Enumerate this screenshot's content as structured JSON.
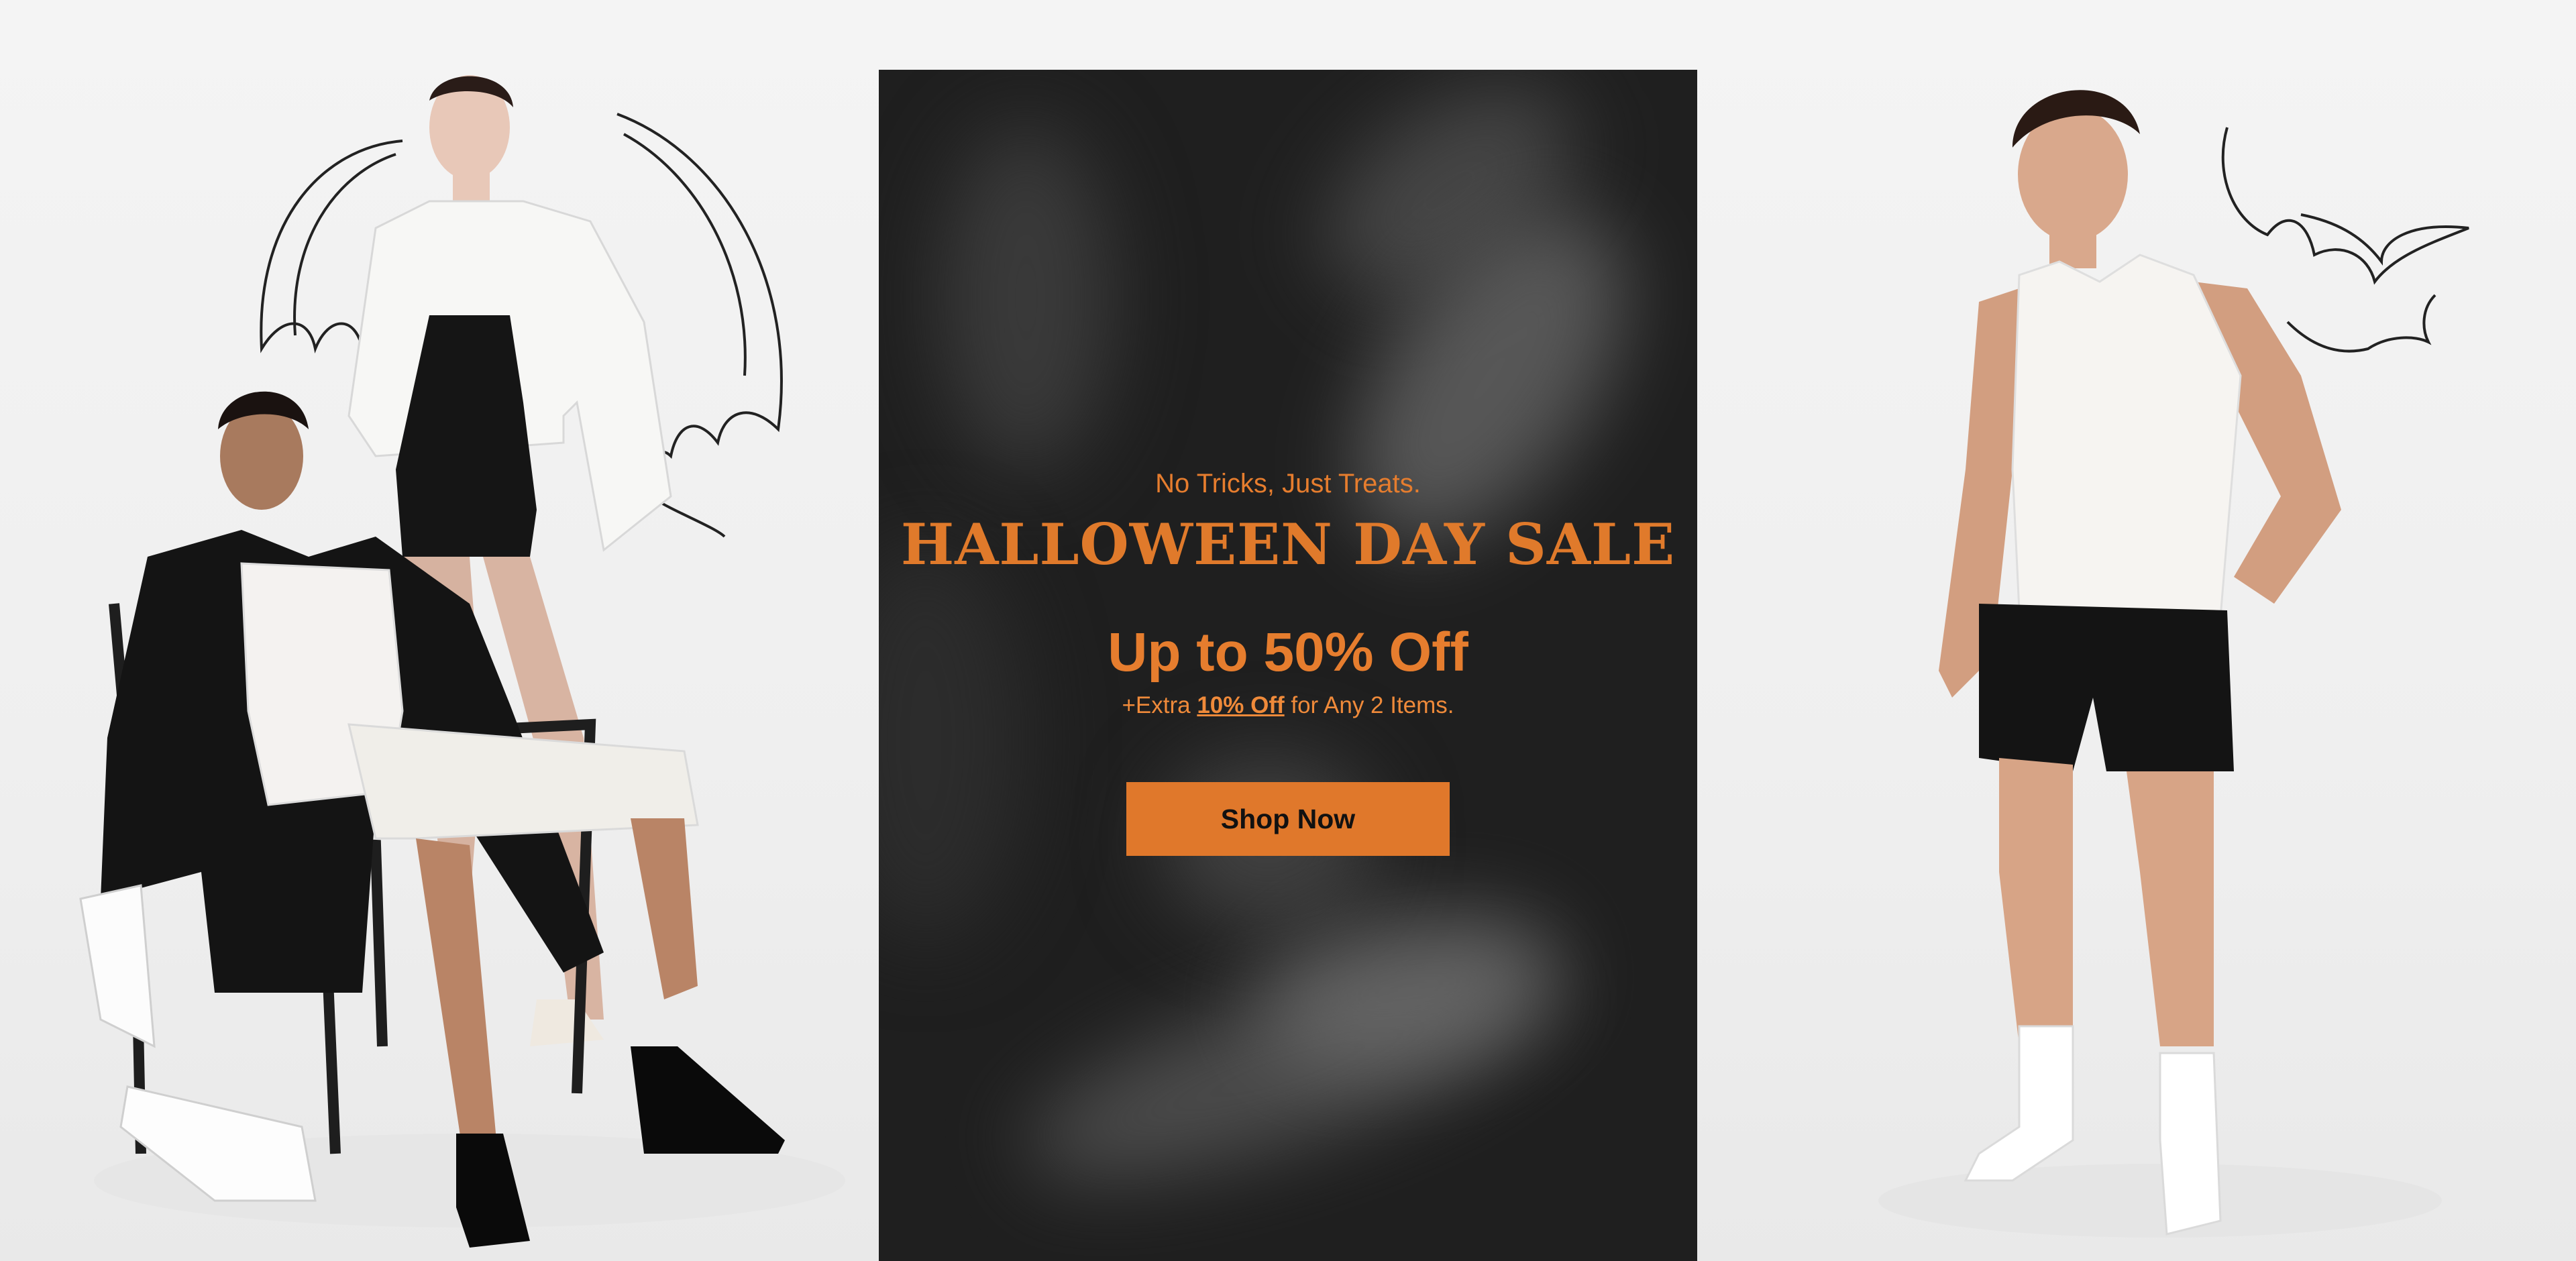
{
  "banner": {
    "eyebrow": "No Tricks, Just Treats.",
    "headline": "HALLOWEEN DAY SALE",
    "discount": "Up to 50% Off",
    "extra": {
      "prefix": "+Extra ",
      "highlight": "10% Off",
      "suffix": " for Any 2 Items."
    },
    "cta_label": "Shop Now"
  },
  "icons": {
    "left_decoration": "bat-wings-icon",
    "right_decoration": "bats-icon"
  },
  "colors": {
    "accent": "#e0782b",
    "panel": "#1f1f1f",
    "background": "#f2f2f2"
  }
}
